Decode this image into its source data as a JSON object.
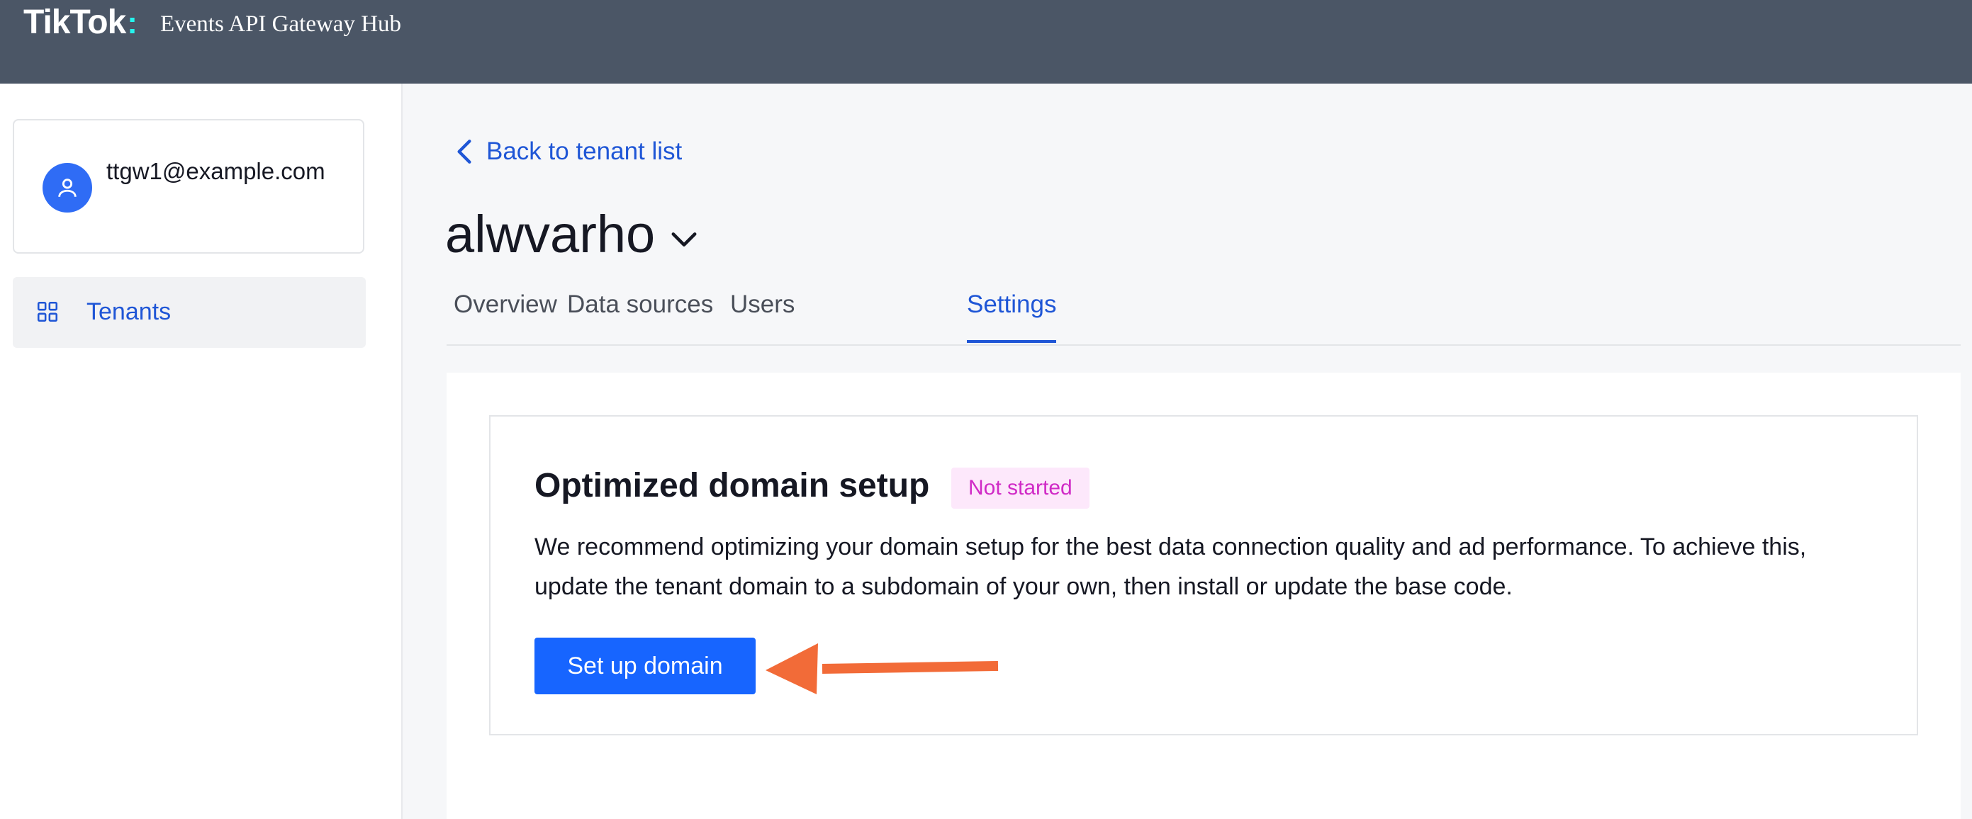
{
  "header": {
    "brand": "TikTok",
    "brand_dot": ":",
    "app_name": "Events API Gateway Hub"
  },
  "sidebar": {
    "user_email": "ttgw1@example.com",
    "items": [
      {
        "label": "Tenants",
        "icon": "grid-icon"
      }
    ]
  },
  "main": {
    "back_link": "Back to tenant list",
    "tenant_name": "alwvarho",
    "tabs": [
      {
        "label": "Overview"
      },
      {
        "label": "Data sources"
      },
      {
        "label": "Users"
      },
      {
        "label": "Settings",
        "active": true
      }
    ],
    "domain_card": {
      "title": "Optimized domain setup",
      "status": "Not started",
      "description": "We recommend optimizing your domain setup for the best data connection quality and ad performance. To achieve this, update the tenant domain to a subdomain of your own, then install or update the base code.",
      "button_label": "Set up domain"
    }
  },
  "colors": {
    "header_bg": "#4b5666",
    "accent": "#1f56d6",
    "primary_button": "#1765ff",
    "badge_bg": "#fde8fb",
    "badge_text": "#d02ac6",
    "annotation_arrow": "#f26b38"
  }
}
